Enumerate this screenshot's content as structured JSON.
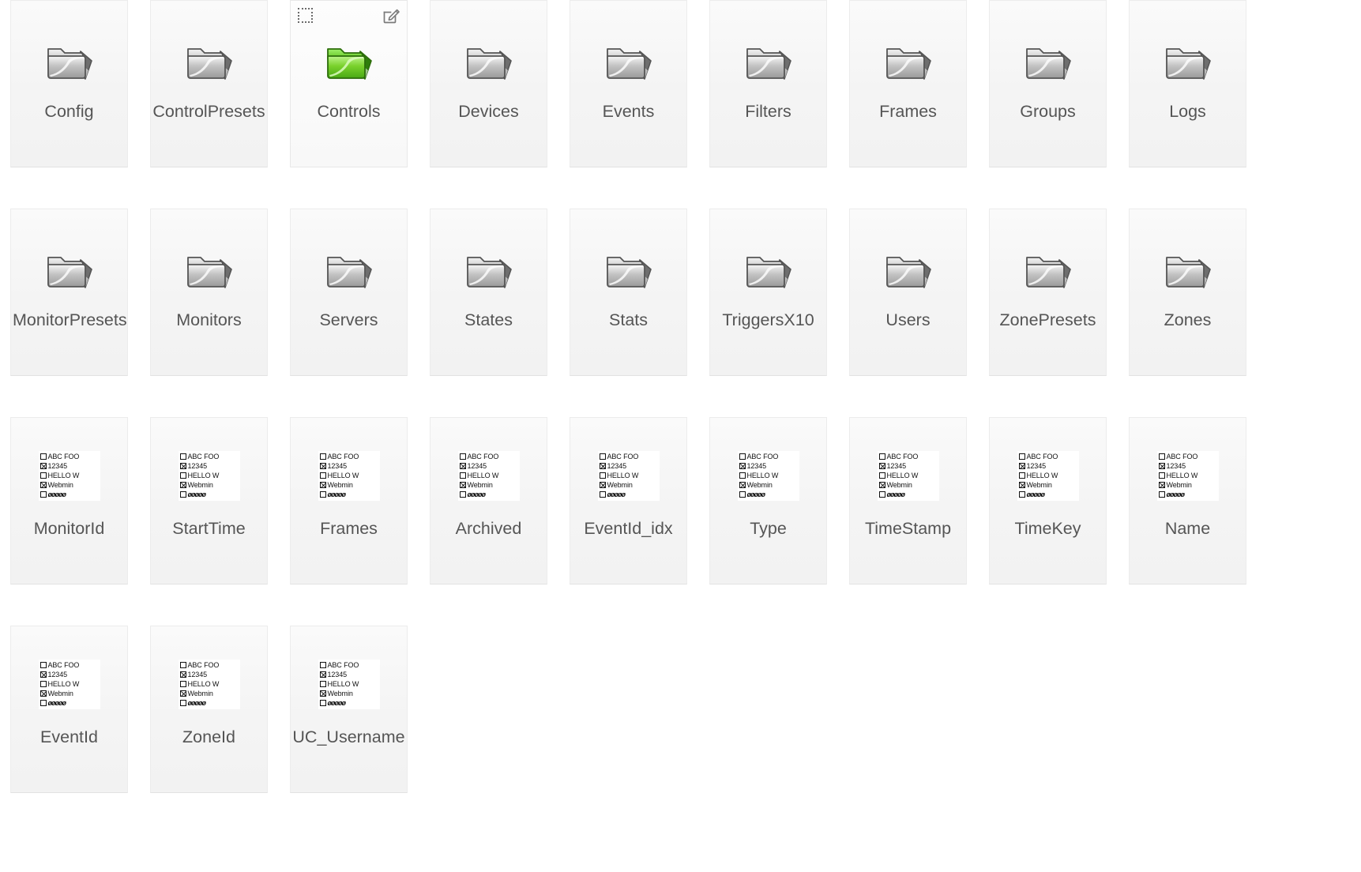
{
  "view": {
    "type": "icon-grid",
    "background_color": "#ffffff",
    "tile_color": "#f4f4f4",
    "label_color": "#555555",
    "selected_item": "Controls"
  },
  "icons": {
    "folder": "folder-icon",
    "folder_selected": "folder-icon-green",
    "table": "database-table-icon",
    "checkbox": "selection-checkbox-icon",
    "edit": "edit-pencil-icon"
  },
  "table_icon_rows": [
    {
      "checked": false,
      "text": "ABC FOO"
    },
    {
      "checked": true,
      "text": "12345"
    },
    {
      "checked": false,
      "text": "HELLO W"
    },
    {
      "checked": true,
      "text": "Webmin"
    },
    {
      "checked": false,
      "text": "øøøøø"
    }
  ],
  "rows": [
    {
      "items": [
        {
          "label": "Config",
          "kind": "folder",
          "selected": false
        },
        {
          "label": "ControlPresets",
          "kind": "folder",
          "selected": false
        },
        {
          "label": "Controls",
          "kind": "folder",
          "selected": true
        },
        {
          "label": "Devices",
          "kind": "folder",
          "selected": false
        },
        {
          "label": "Events",
          "kind": "folder",
          "selected": false
        },
        {
          "label": "Filters",
          "kind": "folder",
          "selected": false
        },
        {
          "label": "Frames",
          "kind": "folder",
          "selected": false
        },
        {
          "label": "Groups",
          "kind": "folder",
          "selected": false
        },
        {
          "label": "Logs",
          "kind": "folder",
          "selected": false
        }
      ]
    },
    {
      "items": [
        {
          "label": "MonitorPresets",
          "kind": "folder",
          "selected": false
        },
        {
          "label": "Monitors",
          "kind": "folder",
          "selected": false
        },
        {
          "label": "Servers",
          "kind": "folder",
          "selected": false
        },
        {
          "label": "States",
          "kind": "folder",
          "selected": false
        },
        {
          "label": "Stats",
          "kind": "folder",
          "selected": false
        },
        {
          "label": "TriggersX10",
          "kind": "folder",
          "selected": false
        },
        {
          "label": "Users",
          "kind": "folder",
          "selected": false
        },
        {
          "label": "ZonePresets",
          "kind": "folder",
          "selected": false
        },
        {
          "label": "Zones",
          "kind": "folder",
          "selected": false
        }
      ]
    },
    {
      "items": [
        {
          "label": "MonitorId",
          "kind": "table",
          "selected": false
        },
        {
          "label": "StartTime",
          "kind": "table",
          "selected": false
        },
        {
          "label": "Frames",
          "kind": "table",
          "selected": false
        },
        {
          "label": "Archived",
          "kind": "table",
          "selected": false
        },
        {
          "label": "EventId_idx",
          "kind": "table",
          "selected": false
        },
        {
          "label": "Type",
          "kind": "table",
          "selected": false
        },
        {
          "label": "TimeStamp",
          "kind": "table",
          "selected": false
        },
        {
          "label": "TimeKey",
          "kind": "table",
          "selected": false
        },
        {
          "label": "Name",
          "kind": "table",
          "selected": false
        }
      ]
    },
    {
      "items": [
        {
          "label": "EventId",
          "kind": "table",
          "selected": false
        },
        {
          "label": "ZoneId",
          "kind": "table",
          "selected": false
        },
        {
          "label": "UC_Username",
          "kind": "table",
          "selected": false
        }
      ]
    }
  ]
}
